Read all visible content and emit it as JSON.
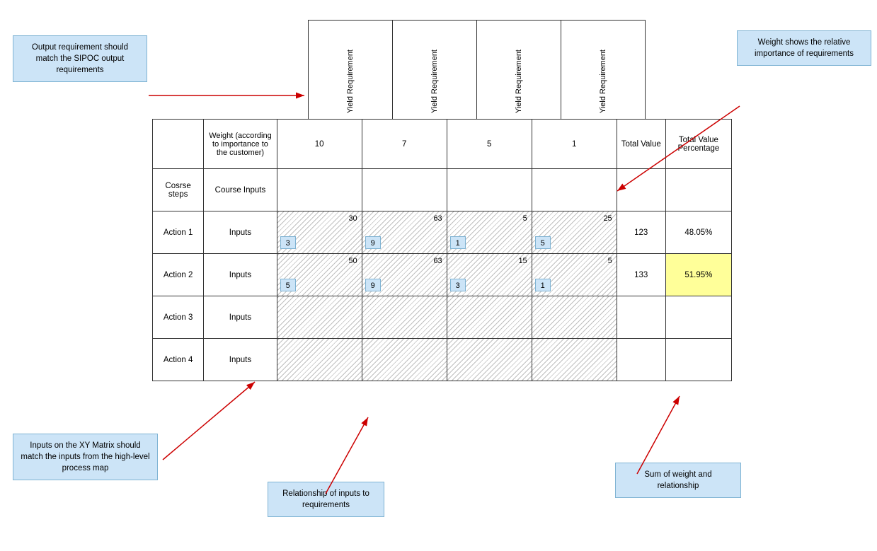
{
  "callouts": {
    "output_req": {
      "text": "Output requirement should match the SIPOC output requirements",
      "style": "top:50px; left:18px; width:190px;"
    },
    "weight_info": {
      "text": "Weight shows the relative importance of requirements",
      "style": "top:43px; right:8px; width:190px;"
    },
    "inputs_info": {
      "text": "Inputs on the XY Matrix should match the inputs from the high-level process map",
      "style": "bottom:100px; left:18px; width:200px;"
    },
    "relationship_info": {
      "text": "Relationship of inputs to requirements",
      "style": "bottom:48px; left:380px; width:165px;"
    },
    "sum_info": {
      "text": "Sum of weight and relationship",
      "style": "bottom:80px; right:195px; width:175px;"
    }
  },
  "columns": {
    "headers": [
      {
        "label": "Yield Requirement",
        "id": "col1"
      },
      {
        "label": "Yield Requirement",
        "id": "col2"
      },
      {
        "label": "Yield Requirement",
        "id": "col3"
      },
      {
        "label": "Yield Requirement",
        "id": "col4"
      }
    ],
    "weights": [
      "10",
      "7",
      "5",
      "1"
    ],
    "total_value": "Total Value",
    "total_pct": "Total Value Percentage"
  },
  "rows": {
    "header": {
      "steps_label": "Cosrse steps",
      "inputs_label": "Course Inputs"
    },
    "data": [
      {
        "action": "Action 1",
        "inputs": "Inputs",
        "cells": [
          {
            "top": "30",
            "bottom": "3"
          },
          {
            "top": "63",
            "bottom": "9"
          },
          {
            "top": "5",
            "bottom": "1"
          },
          {
            "top": "25",
            "bottom": "5"
          }
        ],
        "total": "123",
        "pct": "48.05%",
        "highlight": false
      },
      {
        "action": "Action 2",
        "inputs": "Inputs",
        "cells": [
          {
            "top": "50",
            "bottom": "5"
          },
          {
            "top": "63",
            "bottom": "9"
          },
          {
            "top": "15",
            "bottom": "3"
          },
          {
            "top": "5",
            "bottom": "1"
          }
        ],
        "total": "133",
        "pct": "51.95%",
        "highlight": true
      },
      {
        "action": "Action 3",
        "inputs": "Inputs",
        "cells": [
          {
            "top": "",
            "bottom": ""
          },
          {
            "top": "",
            "bottom": ""
          },
          {
            "top": "",
            "bottom": ""
          },
          {
            "top": "",
            "bottom": ""
          }
        ],
        "total": "",
        "pct": "",
        "highlight": false
      },
      {
        "action": "Action 4",
        "inputs": "Inputs",
        "cells": [
          {
            "top": "",
            "bottom": ""
          },
          {
            "top": "",
            "bottom": ""
          },
          {
            "top": "",
            "bottom": ""
          },
          {
            "top": "",
            "bottom": ""
          }
        ],
        "total": "",
        "pct": "",
        "highlight": false
      }
    ]
  }
}
